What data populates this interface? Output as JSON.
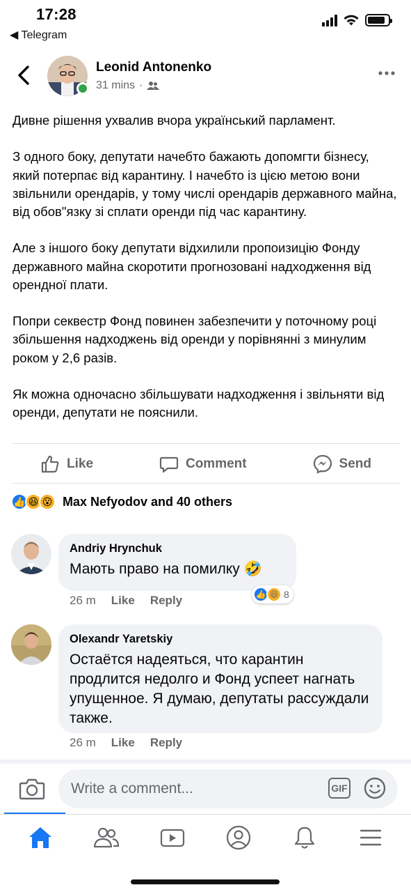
{
  "status_bar": {
    "time": "17:28",
    "back_app": "◀ Telegram",
    "battery_level": 0.85
  },
  "post": {
    "author": "Leonid Antonenko",
    "time_ago": "31 mins",
    "separator": "·",
    "audience_icon": "friends-icon",
    "paragraphs": [
      "Дивне рішення ухвалив вчора український парламент.",
      "З одного боку, депутати начебто бажають допомгти бізнесу, який потерпає від карантину. І начебто із цією метою вони звільнили орендарів, у тому числі орендарів державного майна, від обов\"язку зі сплати оренди під час карантину.",
      "Але з іншого боку депутати відхилили пропоизицію Фонду державного майна скоротити прогнозовані надходження від орендної плати.",
      "Попри секвестр Фонд повинен забезпечити у поточному році збільшення надходжень від оренди у порівнянні з минулим роком у 2,6 разів.",
      "Як можна одночасно збільшувати надходження і звільняти від оренди, депутати не пояснили."
    ]
  },
  "actions": {
    "like": "Like",
    "comment": "Comment",
    "send": "Send"
  },
  "reactions": {
    "summary": "Max Nefyodov and 40 others",
    "icons": [
      "like-reaction-icon",
      "haha-reaction-icon",
      "wow-reaction-icon"
    ]
  },
  "comments": [
    {
      "author": "Andriy Hrynchuk",
      "text": "Мають право на помилку 🤣",
      "time": "26 m",
      "like": "Like",
      "reply": "Reply",
      "reaction_count": "8"
    },
    {
      "author": "Olexandr Yaretskiy",
      "text": "Остаётся надеяться, что карантин продлится недолго и Фонд успеет нагнать упущенное. Я думаю, депутаты рассуждали также.",
      "time": "26 m",
      "like": "Like",
      "reply": "Reply"
    }
  ],
  "composer": {
    "placeholder": "Write a comment...",
    "gif_label": "GIF"
  },
  "bottom_nav": {
    "items": [
      "home-icon",
      "friends-icon",
      "watch-icon",
      "profile-icon",
      "notifications-icon",
      "menu-icon"
    ],
    "active": "home-icon"
  },
  "colors": {
    "brand_blue": "#1877f2",
    "online_green": "#31a24c",
    "secondary_text": "#65676b",
    "bubble_bg": "#f0f2f5"
  }
}
